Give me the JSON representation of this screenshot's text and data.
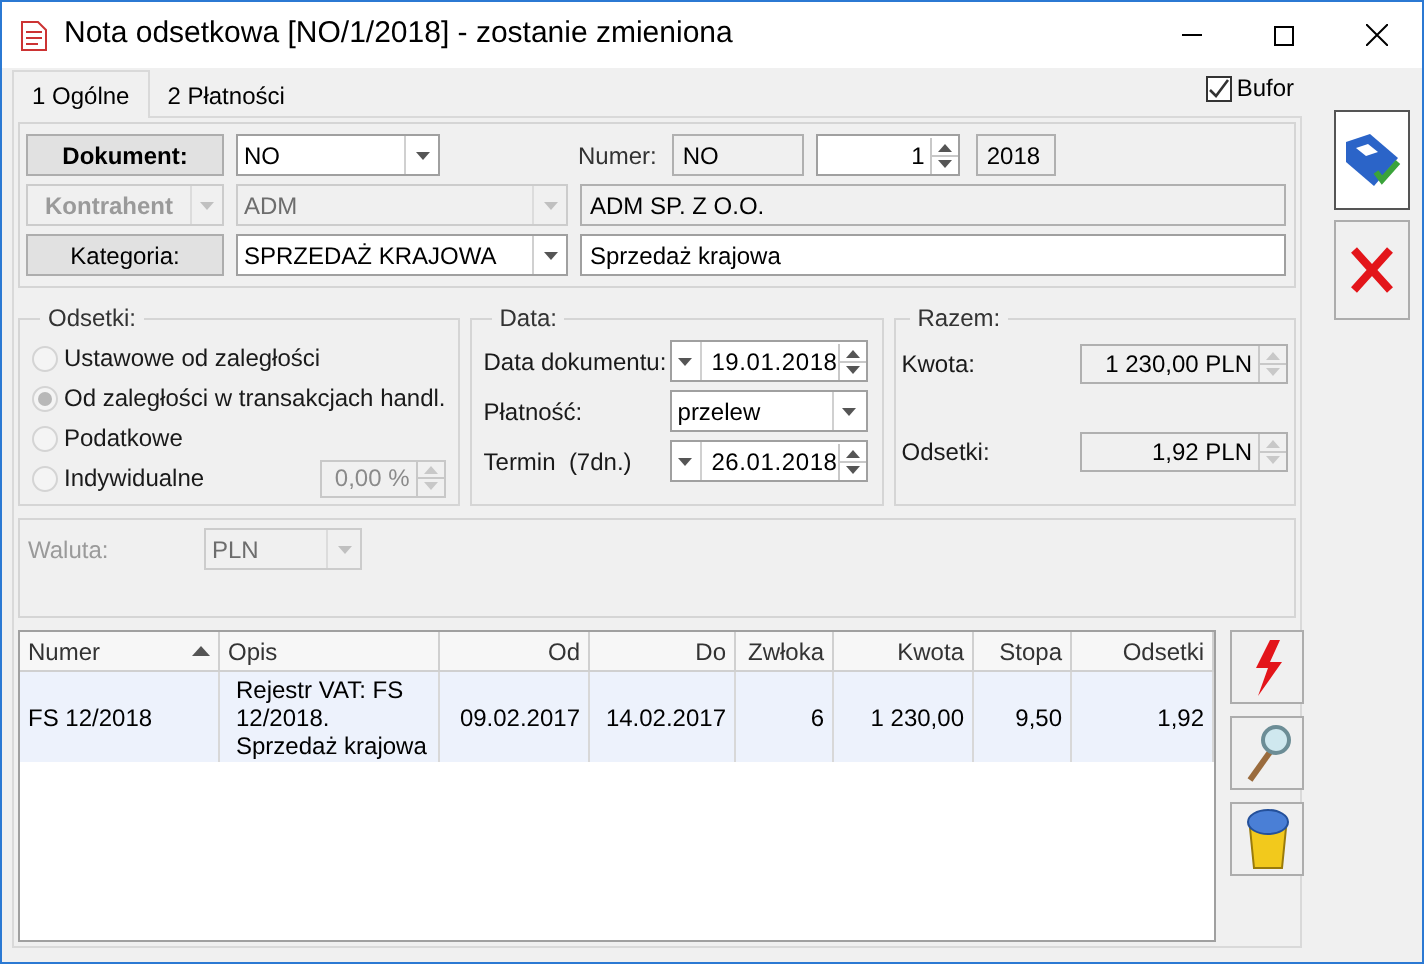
{
  "window": {
    "title": "Nota odsetkowa [NO/1/2018] - zostanie zmieniona"
  },
  "tabs": [
    {
      "label": "1 Ogólne",
      "selected": true
    },
    {
      "label": "2 Płatności",
      "selected": false
    }
  ],
  "bufor": {
    "label": "Bufor",
    "checked": true
  },
  "header": {
    "dokument": {
      "label": "Dokument:",
      "value": "NO",
      "disabled": false
    },
    "numer": {
      "label": "Numer:",
      "prefix": "NO",
      "number": "1",
      "year": "2018"
    },
    "kontrahent": {
      "label": "Kontrahent",
      "code": "ADM",
      "name": "ADM SP. Z O.O.",
      "disabled": true
    },
    "kategoria": {
      "label": "Kategoria:",
      "value": "SPRZEDAŻ KRAJOWA",
      "description": "Sprzedaż krajowa",
      "disabled": false
    }
  },
  "odsetki": {
    "title": "Odsetki:",
    "options": [
      {
        "label": "Ustawowe od zaległości",
        "selected": false
      },
      {
        "label": "Od zaległości w transakcjach handl.",
        "selected": true
      },
      {
        "label": "Podatkowe",
        "selected": false
      },
      {
        "label": "Indywidualne",
        "selected": false
      }
    ],
    "rate": "0,00 %"
  },
  "data": {
    "title": "Data:",
    "rows": [
      {
        "kind": "date",
        "label": "Data dokumentu:",
        "value": "19.01.2018"
      },
      {
        "kind": "combo",
        "label": "Płatność:",
        "value": "przelew"
      },
      {
        "kind": "date",
        "label": "Termin  (7dn.)",
        "value": "26.01.2018"
      }
    ]
  },
  "razem": {
    "title": "Razem:",
    "rows": [
      {
        "label": "Kwota:",
        "value": "1 230,00 PLN"
      },
      {
        "label": "Odsetki:",
        "value": "1,92 PLN"
      }
    ]
  },
  "waluta": {
    "label": "Waluta:",
    "value": "PLN"
  },
  "table": {
    "columns": [
      {
        "label": "Numer",
        "sorted": true
      },
      {
        "label": "Opis",
        "sorted": false
      },
      {
        "label": "Od",
        "sorted": false
      },
      {
        "label": "Do",
        "sorted": false
      },
      {
        "label": "Zwłoka",
        "sorted": false
      },
      {
        "label": "Kwota",
        "sorted": false
      },
      {
        "label": "Stopa",
        "sorted": false
      },
      {
        "label": "Odsetki",
        "sorted": false
      }
    ],
    "rows": [
      {
        "selected": true,
        "cells": [
          "FS 12/2018",
          "Rejestr VAT: FS 12/2018. Sprzedaż krajowa",
          "09.02.2017",
          "14.02.2017",
          "6",
          "1 230,00",
          "9,50",
          "1,92"
        ]
      }
    ]
  }
}
